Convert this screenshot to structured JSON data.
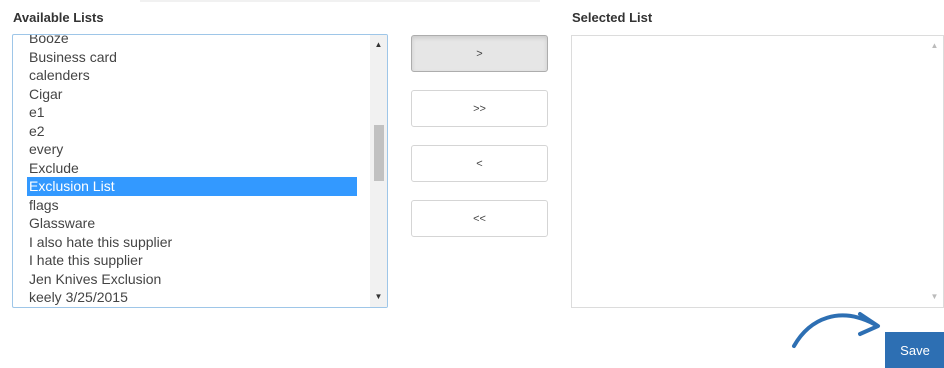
{
  "available_label": "Available Lists",
  "selected_label": "Selected List",
  "available_items": [
    "Booze",
    "Business card",
    "calenders",
    "Cigar",
    "e1",
    "e2",
    "every",
    "Exclude",
    "Exclusion List",
    "flags",
    "Glassware",
    "I also hate this supplier",
    "I hate this supplier",
    "Jen Knives Exclusion",
    "keely 3/25/2015"
  ],
  "selected_item": "Exclusion List",
  "buttons": {
    "move_selected": ">",
    "move_all": ">>",
    "remove_selected": "<",
    "remove_all": "<<",
    "save": "Save"
  },
  "colors": {
    "selection": "#3399ff",
    "save_button": "#2d6fb3",
    "annotation_arrow": "#2d6fb3"
  },
  "icons": {
    "scroll_up": "▲",
    "scroll_down": "▼"
  }
}
